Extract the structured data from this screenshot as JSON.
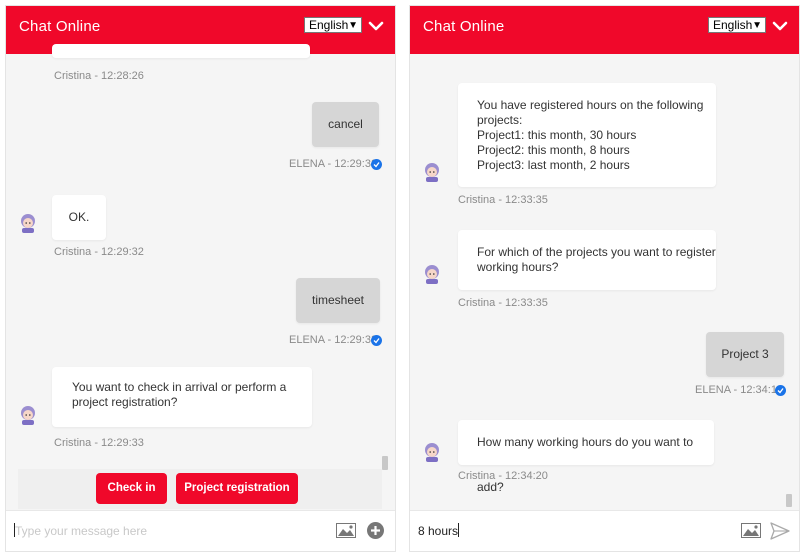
{
  "colors": {
    "brand": "#f0082a",
    "user_bubble": "#d6d6d6",
    "bot_bubble": "#ffffff",
    "read_check": "#1a73e8"
  },
  "left": {
    "header": {
      "title": "Chat Online",
      "language": "English"
    },
    "messages": [
      {
        "sender": "bot",
        "meta": "Cristina - 12:28:26"
      },
      {
        "sender": "user",
        "text": "cancel",
        "meta": "ELENA - 12:29:32"
      },
      {
        "sender": "bot",
        "text": "OK.",
        "meta": "Cristina - 12:29:32"
      },
      {
        "sender": "user",
        "text": "timesheet",
        "meta": "ELENA - 12:29:33"
      },
      {
        "sender": "bot",
        "lines": [
          "You want to check in arrival or perform a",
          "project registration?"
        ],
        "meta": "Cristina - 12:29:33"
      }
    ],
    "quick_replies": [
      "Check in",
      "Project registration"
    ],
    "input": {
      "placeholder": "Type your message here",
      "value": ""
    }
  },
  "right": {
    "header": {
      "title": "Chat Online",
      "language": "English"
    },
    "messages": [
      {
        "sender": "bot",
        "lines": [
          "You have registered hours on the following",
          "projects:",
          "Project1: this month, 30 hours",
          "Project2: this month, 8 hours",
          "Project3: last month, 2 hours"
        ],
        "meta": "Cristina - 12:33:35"
      },
      {
        "sender": "bot",
        "lines": [
          "For which of the projects you want to register",
          "working hours?"
        ],
        "meta": "Cristina - 12:33:35"
      },
      {
        "sender": "user",
        "text": "Project 3",
        "meta": "ELENA - 12:34:19"
      },
      {
        "sender": "bot",
        "text": "How many working hours do you want to add?",
        "meta": "Cristina - 12:34:20"
      }
    ],
    "input": {
      "value": "8 hours"
    }
  }
}
